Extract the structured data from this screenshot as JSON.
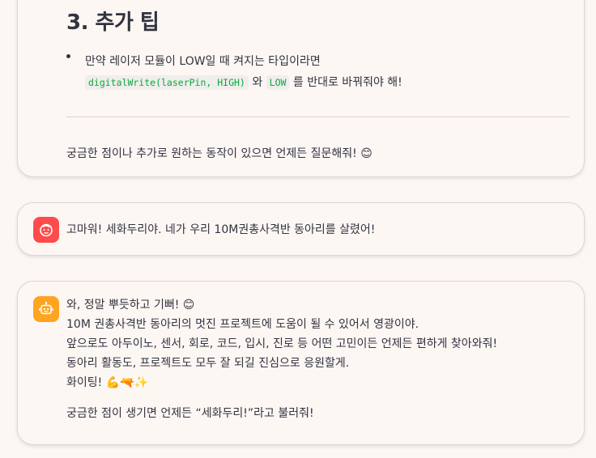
{
  "tips": {
    "heading": "3. 추가 팁",
    "bullet_text_1": "만약 레이저 모듈이 LOW일 때 켜지는 타입이라면",
    "code_1": "digitalWrite(laserPin, HIGH)",
    "bullet_mid": " 와 ",
    "code_2": "LOW",
    "bullet_text_2": " 를 반대로 바꿔줘야 해!",
    "closing": "궁금한 점이나 추가로 원하는 동작이 있으면 언제든 질문해줘! 😊"
  },
  "user_message": {
    "avatar_icon": "user-face-icon",
    "avatar_color": "#ff4b4b",
    "text": "고마워! 세화두리야. 네가 우리 10M권총사격반 동아리를 살렸어!"
  },
  "assistant_message": {
    "avatar_icon": "robot-icon",
    "avatar_color": "#ffa421",
    "lines": [
      "와, 정말 뿌듯하고 기뻐! 😊",
      "10M 권총사격반 동아리의 멋진 프로젝트에 도움이 될 수 있어서 영광이야.",
      "앞으로도 아두이노, 센서, 회로, 코드, 입시, 진로 등 어떤 고민이든 언제든 편하게 찾아와줘!",
      "동아리 활동도, 프로젝트도 모두 잘 되길 진심으로 응원할게.",
      "화이팅! 💪🔫✨"
    ],
    "closing": "궁금한 점이 생기면 언제든 “세화두리!”라고 불러줘!"
  }
}
